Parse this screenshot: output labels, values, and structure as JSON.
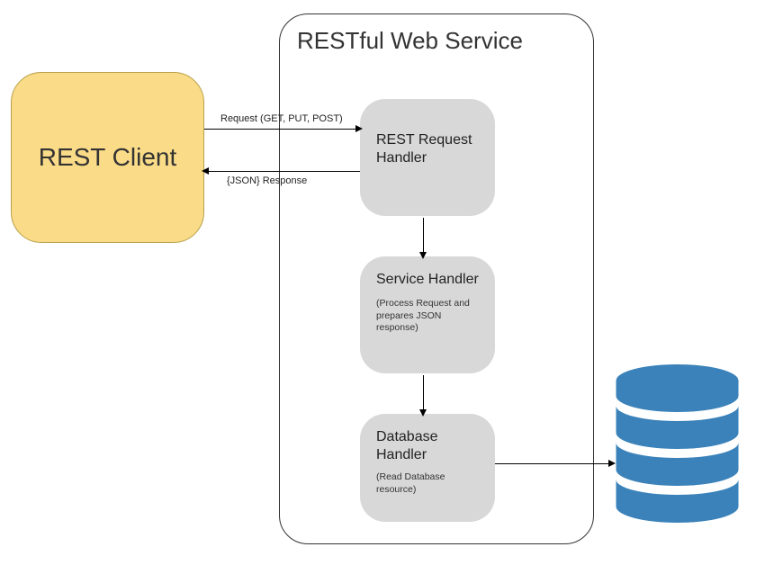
{
  "client": {
    "label": "REST Client"
  },
  "service": {
    "title": "RESTful Web Service",
    "requestHandler": {
      "title": "REST Request Handler"
    },
    "serviceHandler": {
      "title": "Service Handler",
      "subtitle": "(Process Request and prepares JSON response)"
    },
    "databaseHandler": {
      "title": "Database Handler",
      "subtitle": "(Read Database resource)"
    }
  },
  "arrows": {
    "requestLabel": "Request (GET, PUT, POST)",
    "responseLabel": "{JSON} Response"
  },
  "colors": {
    "client": "#fadb88",
    "handler": "#d8d8d8",
    "database": "#3a82b9"
  }
}
